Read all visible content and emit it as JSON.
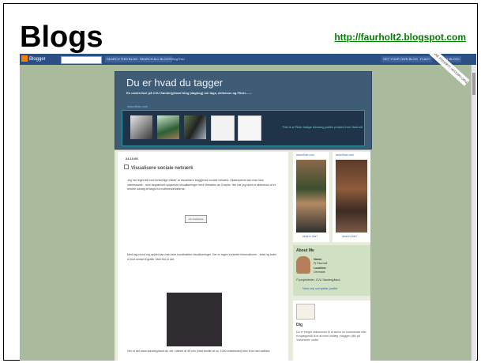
{
  "slide": {
    "title": "Blogs",
    "link": "http://faurholt2.blogspot.com"
  },
  "navbar": {
    "logo": "Blogger",
    "buttons": [
      "SEARCH THIS BLOG",
      "SEARCH ALL BLOGS",
      "BlogThis!"
    ],
    "right_links": [
      "GET YOUR OWN BLOG",
      "FLAG?",
      "NEXT BLOG»"
    ],
    "ribbon": "MAKE POVERTY HISTORY.ORG"
  },
  "header": {
    "title": "Du er hvad du tagger",
    "description": "En underviser på CVU Sønderjylland blog (dagbog) om tags, delicious og Flickr.......",
    "flickr_label": "www.flickr.com",
    "flickr_link": "This is a Flickr badge showing public photos from faurholt"
  },
  "post": {
    "date": "24.10.06",
    "title": "Visualisere sociale netværk",
    "para1": "Jeg har leget lidt med forskellige måder at visualisere bloggenes sociale netværk. Eksempelvis kan man lave interessante - men begrænset oplysende visualiseringer med Websites as Graphs. Her har jeg lavet et slideshow af et mindre udvalg af blogs fra multimediefolderne.",
    "image_label": "Um brebbeuts",
    "para2": "Med tag-cloud.org applet kan man lave hundtrække visualiseringer. Der er ingen konkrete informationer - tekst og tuder er blot omsat til grafik. Men flot er det.",
    "para3": "Her er det www.sonderjylland.dk, der i takset af 45 min (Intet beslår af ca. 1000 enkeltsider) blev til en tæt radblov."
  },
  "sidebar": {
    "flickr1": "www.flickr.com",
    "flickr2": "www.flickr.com",
    "flickr_caption1": "what is this?",
    "flickr_caption2": "what is this?",
    "about_title": "About Me",
    "about": {
      "name_label": "Name:",
      "name": "Pj Faurholt",
      "location_label": "Location:",
      "location": "Denmark",
      "bio": "IT-projektleder, CVU Sønderjylland.",
      "profile_link": "View my complete profile"
    },
    "dig_title": "Dig",
    "dig_text": "Du er meget velkommen til at skrive en kommentar eller et spørgsmål til et af mine indlæg i bloggen (klik på 'comments' under"
  },
  "colors": {
    "slide_link": "#008000",
    "nav_bg": "#2a4f84",
    "page_bg": "#a9bb9c",
    "header_bg": "#3f5c77"
  },
  "icons": {
    "logo": "blogger-b-icon",
    "post_bullet": "square-bullet-icon"
  }
}
